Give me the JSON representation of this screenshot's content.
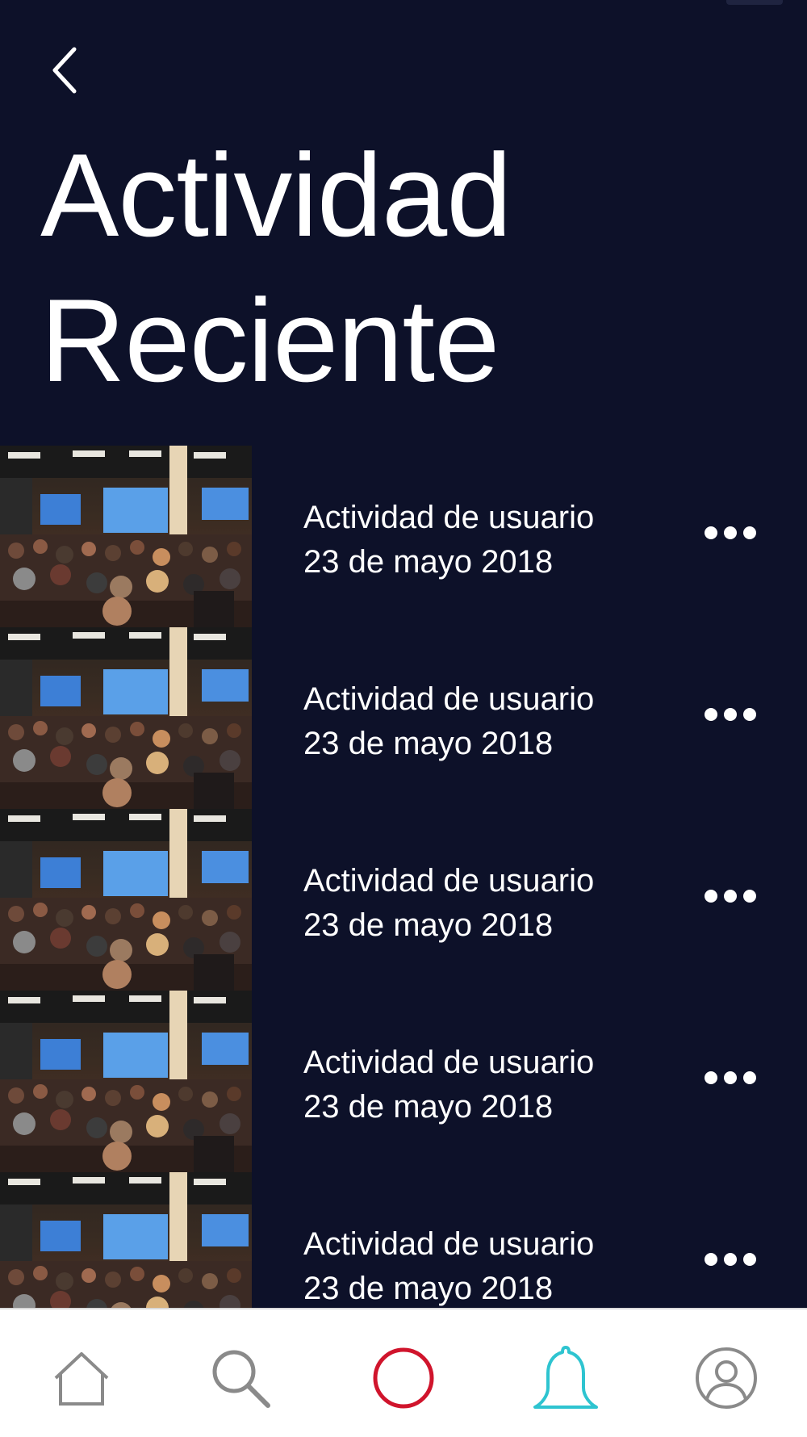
{
  "header": {
    "back_icon": "chevron-left-icon",
    "title_line1": "Actividad",
    "title_line2": "Reciente"
  },
  "activities": [
    {
      "title": "Actividad de usuario",
      "date": "23 de mayo 2018",
      "thumbnail": "conference-audience-photo",
      "menu_icon": "more-horizontal-icon"
    },
    {
      "title": "Actividad de usuario",
      "date": "23 de mayo 2018",
      "thumbnail": "conference-audience-photo",
      "menu_icon": "more-horizontal-icon"
    },
    {
      "title": "Actividad de usuario",
      "date": "23 de mayo 2018",
      "thumbnail": "conference-audience-photo",
      "menu_icon": "more-horizontal-icon"
    },
    {
      "title": "Actividad de usuario",
      "date": "23 de mayo 2018",
      "thumbnail": "conference-audience-photo",
      "menu_icon": "more-horizontal-icon"
    },
    {
      "title": "Actividad de usuario",
      "date": "23 de mayo 2018",
      "thumbnail": "conference-audience-photo",
      "menu_icon": "more-horizontal-icon"
    }
  ],
  "tabbar": {
    "items": [
      {
        "icon": "home-icon",
        "active": false
      },
      {
        "icon": "search-icon",
        "active": false
      },
      {
        "icon": "record-circle-icon",
        "active": false
      },
      {
        "icon": "bell-icon",
        "active": true
      },
      {
        "icon": "profile-icon",
        "active": false
      }
    ]
  },
  "colors": {
    "background": "#0d1129",
    "text": "#ffffff",
    "tab_inactive": "#8a8a8a",
    "tab_active": "#2ec4d0",
    "record": "#d0142c",
    "tabbar_bg": "#ffffff"
  }
}
